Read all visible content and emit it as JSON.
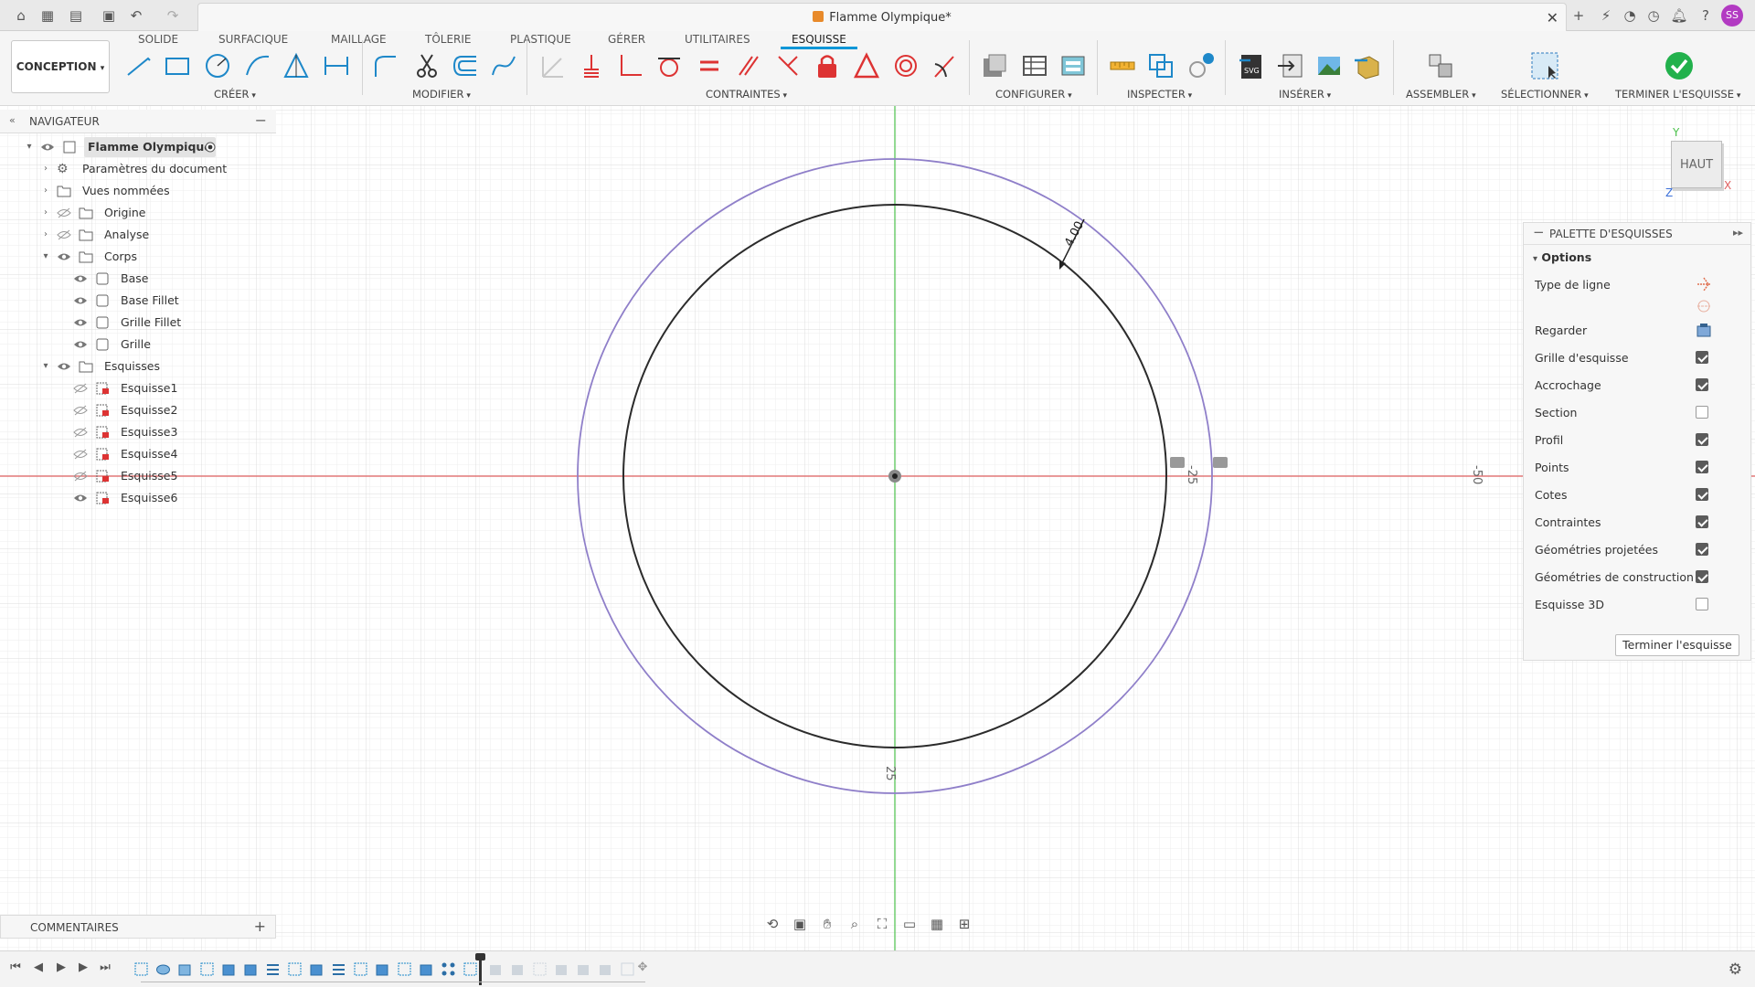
{
  "titlebar": {
    "document_title": "Flamme Olympique*",
    "avatar_initials": "SS"
  },
  "ribbon": {
    "workspace": "CONCEPTION",
    "tabs": [
      "SOLIDE",
      "SURFACIQUE",
      "MAILLAGE",
      "TÔLERIE",
      "PLASTIQUE",
      "GÉRER",
      "UTILITAIRES",
      "ESQUISSE"
    ],
    "active_tab": "ESQUISSE",
    "groups": {
      "create": "CRÉER",
      "modify": "MODIFIER",
      "constraints": "CONTRAINTES",
      "configure": "CONFIGURER",
      "inspect": "INSPECTER",
      "insert": "INSÉRER",
      "assemble": "ASSEMBLER",
      "select": "SÉLECTIONNER",
      "finish": "TERMINER L'ESQUISSE"
    }
  },
  "navigator": {
    "title": "NAVIGATEUR",
    "root": "Flamme Olympique",
    "items": [
      {
        "label": "Paramètres du document"
      },
      {
        "label": "Vues nommées"
      },
      {
        "label": "Origine"
      },
      {
        "label": "Analyse"
      },
      {
        "label": "Corps"
      },
      {
        "label": "Base"
      },
      {
        "label": "Base Fillet"
      },
      {
        "label": "Grille Fillet"
      },
      {
        "label": "Grille"
      },
      {
        "label": "Esquisses"
      },
      {
        "label": "Esquisse1"
      },
      {
        "label": "Esquisse2"
      },
      {
        "label": "Esquisse3"
      },
      {
        "label": "Esquisse4"
      },
      {
        "label": "Esquisse5"
      },
      {
        "label": "Esquisse6"
      }
    ]
  },
  "comments": {
    "title": "COMMENTAIRES"
  },
  "canvas": {
    "dimension_value": "4.00",
    "ruler_labels": [
      "25",
      "-25",
      "-50"
    ],
    "viewcube_label": "HAUT",
    "axis_labels": {
      "y": "Y",
      "x": "X",
      "z": "Z"
    }
  },
  "palette": {
    "title": "PALETTE D'ESQUISSES",
    "section": "Options",
    "line_type": "Type de ligne",
    "look_at": "Regarder",
    "options": [
      {
        "label": "Grille d'esquisse",
        "checked": true
      },
      {
        "label": "Accrochage",
        "checked": true
      },
      {
        "label": "Section",
        "checked": false
      },
      {
        "label": "Profil",
        "checked": true
      },
      {
        "label": "Points",
        "checked": true
      },
      {
        "label": "Cotes",
        "checked": true
      },
      {
        "label": "Contraintes",
        "checked": true
      },
      {
        "label": "Géométries projetées",
        "checked": true
      },
      {
        "label": "Géométries de construction",
        "checked": true
      },
      {
        "label": "Esquisse 3D",
        "checked": false
      }
    ],
    "finish_button": "Terminer l'esquisse"
  },
  "colors": {
    "accent": "#0696d7",
    "outer_circle": "#8f7fc9",
    "inner_circle": "#2b2b2b",
    "x_axis": "#e06060",
    "y_axis": "#4cc24c",
    "finish_check": "#22b14c"
  }
}
